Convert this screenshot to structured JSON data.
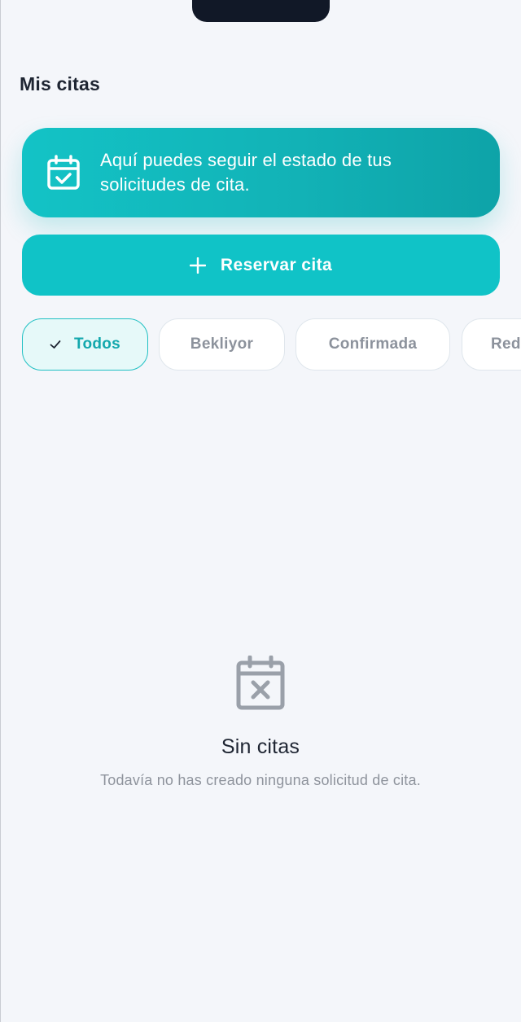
{
  "header": {
    "title": "Mis citas"
  },
  "info_card": {
    "icon": "calendar-check-icon",
    "text_line1": "Aquí puedes seguir el estado de tus",
    "text_line2": "solicitudes de cita."
  },
  "reserve": {
    "icon": "plus-icon",
    "label": "Reservar cita"
  },
  "filters": {
    "items": [
      {
        "label": "Todos",
        "selected": true
      },
      {
        "label": "Bekliyor",
        "selected": false
      },
      {
        "label": "Confirmada",
        "selected": false
      },
      {
        "label": "Red",
        "selected": false
      }
    ]
  },
  "empty": {
    "icon": "calendar-x-icon",
    "title": "Sin citas",
    "subtitle": "Todavía no has creado ninguna solicitud de cita."
  },
  "colors": {
    "accent": "#10c3c7",
    "accent_dark": "#13a8ad",
    "background": "#f4f6fa",
    "muted_text": "#8e939c"
  }
}
